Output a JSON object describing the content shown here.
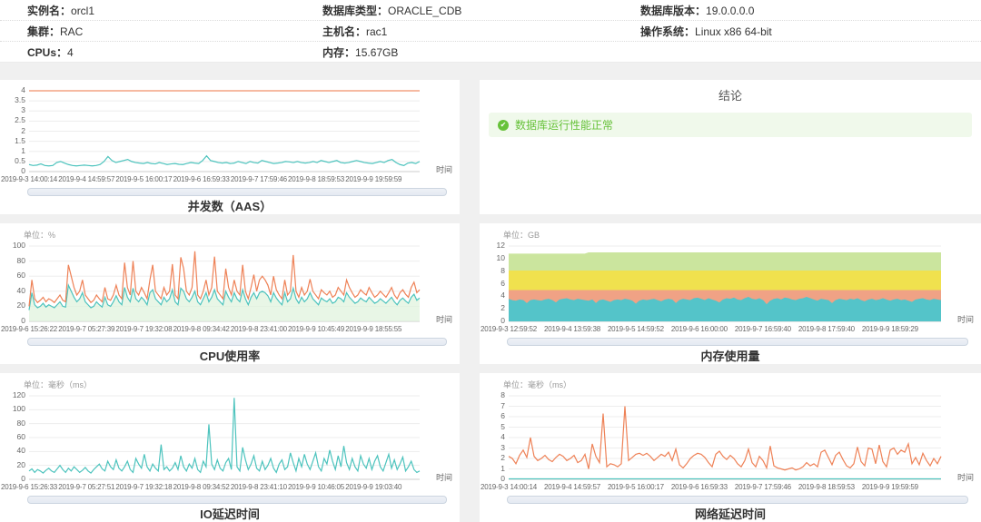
{
  "header": {
    "rows": [
      [
        {
          "label": "实例名：",
          "value": "orcl1"
        },
        {
          "label": "数据库类型：",
          "value": "ORACLE_CDB"
        },
        {
          "label": "数据库版本：",
          "value": "19.0.0.0.0"
        }
      ],
      [
        {
          "label": "集群：",
          "value": "RAC"
        },
        {
          "label": "主机名：",
          "value": "rac1"
        },
        {
          "label": "操作系统：",
          "value": "Linux x86 64-bit"
        }
      ],
      [
        {
          "label": "CPUs：",
          "value": "4"
        },
        {
          "label": "内存：",
          "value": "15.67GB"
        }
      ]
    ]
  },
  "conclusion": {
    "title": "结论",
    "icon_glyph": "✔",
    "icon_name": "check-circle-icon",
    "message": "数据库运行性能正常",
    "text_color": "#67c23a",
    "bg_color": "#f0f9eb"
  },
  "colors": {
    "orange_series": "#ee8156",
    "teal_series": "#4cc3bd",
    "mem_green": "#cbe59e",
    "mem_yellow": "#f0e14e",
    "mem_salmon": "#f0a285",
    "mem_teal": "#54c4c9"
  },
  "chart_data": [
    {
      "id": "aas",
      "type": "line",
      "title": "并发数（AAS）",
      "unit": null,
      "xlabel": "时间",
      "ylim": [
        0,
        4
      ],
      "yticks": [
        0,
        0.5,
        1,
        1.5,
        2,
        2.5,
        3,
        3.5,
        4
      ],
      "x_ticks": [
        "2019-9-3 14:00:14",
        "2019-9-4 14:59:57",
        "2019-9-5 16:00:17",
        "2019-9-6 16:59:33",
        "2019-9-7 17:59:46",
        "2019-9-8 18:59:53",
        "2019-9-9 19:59:59"
      ],
      "series": [
        {
          "color": "#f0916b",
          "flat": 4
        },
        {
          "color": "#4cc3bd",
          "values": [
            0.35,
            0.3,
            0.32,
            0.38,
            0.3,
            0.28,
            0.3,
            0.45,
            0.5,
            0.42,
            0.35,
            0.3,
            0.28,
            0.3,
            0.32,
            0.3,
            0.28,
            0.3,
            0.35,
            0.5,
            0.75,
            0.55,
            0.45,
            0.5,
            0.55,
            0.6,
            0.5,
            0.45,
            0.42,
            0.4,
            0.45,
            0.4,
            0.38,
            0.45,
            0.4,
            0.35,
            0.38,
            0.4,
            0.36,
            0.35,
            0.4,
            0.45,
            0.42,
            0.4,
            0.55,
            0.78,
            0.55,
            0.5,
            0.45,
            0.42,
            0.45,
            0.4,
            0.42,
            0.5,
            0.45,
            0.4,
            0.5,
            0.45,
            0.42,
            0.55,
            0.5,
            0.45,
            0.4,
            0.42,
            0.45,
            0.5,
            0.48,
            0.45,
            0.5,
            0.45,
            0.42,
            0.45,
            0.5,
            0.45,
            0.55,
            0.5,
            0.45,
            0.5,
            0.55,
            0.45,
            0.42,
            0.45,
            0.5,
            0.55,
            0.5,
            0.45,
            0.42,
            0.4,
            0.45,
            0.5,
            0.45,
            0.55,
            0.6,
            0.45,
            0.35,
            0.3,
            0.42,
            0.45,
            0.4,
            0.5
          ]
        }
      ]
    },
    {
      "id": "cpu",
      "type": "line",
      "title": "CPU使用率",
      "unit": "单位：%",
      "xlabel": "时间",
      "ylim": [
        0,
        100
      ],
      "yticks": [
        0,
        20,
        40,
        60,
        80,
        100
      ],
      "x_ticks": [
        "2019-9-6 15:26:22",
        "2019-9-7 05:27:39",
        "2019-9-7 19:32:08",
        "2019-9-8 09:34:42",
        "2019-9-8 23:41:00",
        "2019-9-9 10:45:49",
        "2019-9-9 18:55:55"
      ],
      "series": [
        {
          "color": "#4cc3bd",
          "fill": true,
          "fillColor": "rgba(222,242,220,0.7)",
          "values": [
            15,
            38,
            22,
            18,
            20,
            24,
            19,
            22,
            20,
            18,
            22,
            26,
            20,
            19,
            48,
            40,
            32,
            26,
            30,
            38,
            26,
            22,
            18,
            20,
            26,
            22,
            19,
            32,
            22,
            20,
            26,
            34,
            26,
            22,
            45,
            32,
            26,
            44,
            30,
            26,
            32,
            28,
            22,
            38,
            42,
            30,
            26,
            22,
            32,
            26,
            30,
            42,
            26,
            22,
            44,
            40,
            30,
            26,
            32,
            40,
            26,
            22,
            30,
            38,
            26,
            32,
            42,
            30,
            26,
            22,
            40,
            32,
            26,
            38,
            30,
            26,
            42,
            30,
            22,
            32,
            38,
            30,
            38,
            40,
            38,
            34,
            26,
            38,
            31,
            26,
            22,
            38,
            26,
            30,
            44,
            30,
            24,
            32,
            26,
            30,
            38,
            30,
            26,
            22,
            31,
            28,
            26,
            30,
            24,
            26,
            32,
            30,
            26,
            38,
            32,
            28,
            24,
            26,
            31,
            28,
            26,
            32,
            28,
            24,
            26,
            30,
            27,
            24,
            28,
            32,
            26,
            22,
            28,
            31,
            27,
            24,
            32,
            36,
            28,
            31
          ]
        },
        {
          "color": "#ee8156",
          "values": [
            20,
            55,
            30,
            25,
            28,
            32,
            26,
            30,
            28,
            25,
            30,
            35,
            28,
            26,
            75,
            60,
            45,
            35,
            40,
            55,
            35,
            30,
            25,
            28,
            35,
            30,
            26,
            45,
            30,
            28,
            35,
            48,
            35,
            30,
            78,
            45,
            35,
            80,
            40,
            35,
            45,
            38,
            30,
            55,
            75,
            40,
            35,
            30,
            45,
            35,
            40,
            76,
            35,
            30,
            85,
            70,
            40,
            35,
            45,
            93,
            35,
            30,
            40,
            55,
            35,
            45,
            86,
            40,
            35,
            30,
            70,
            45,
            35,
            55,
            40,
            35,
            75,
            40,
            30,
            45,
            62,
            40,
            55,
            60,
            55,
            48,
            35,
            60,
            42,
            35,
            30,
            55,
            35,
            40,
            88,
            40,
            32,
            45,
            35,
            40,
            56,
            40,
            35,
            30,
            42,
            38,
            35,
            40,
            32,
            35,
            45,
            40,
            35,
            55,
            45,
            38,
            32,
            35,
            42,
            38,
            35,
            45,
            38,
            32,
            35,
            40,
            36,
            32,
            38,
            45,
            35,
            30,
            38,
            42,
            36,
            32,
            45,
            52,
            38,
            42
          ]
        }
      ]
    },
    {
      "id": "memory",
      "type": "area-stacked",
      "title": "内存使用量",
      "unit": "单位：GB",
      "xlabel": "时间",
      "ylim": [
        0,
        12
      ],
      "yticks": [
        0,
        2,
        4,
        6,
        8,
        10,
        12
      ],
      "x_ticks": [
        "2019-9-3 12:59:52",
        "2019-9-4 13:59:38",
        "2019-9-5 14:59:52",
        "2019-9-6 16:00:00",
        "2019-9-7 16:59:40",
        "2019-9-8 17:59:40",
        "2019-9-9 18:59:29"
      ],
      "series": [
        {
          "color": "#cbe59e",
          "fill": true,
          "segments": [
            {
              "value": 10.7,
              "count": 22
            },
            {
              "value": 10.9,
              "count": 98
            }
          ]
        },
        {
          "color": "#f0e14e",
          "fill": true,
          "flat": 8
        },
        {
          "color": "#f0a285",
          "fill": true,
          "flat": 4.9
        },
        {
          "color": "#54c4c9",
          "fill": true,
          "values": [
            3.5,
            3.3,
            3.2,
            3.4,
            3.3,
            2.8,
            3.3,
            3.4,
            3.3,
            3.2,
            3.4,
            3.5,
            3.3,
            2.9,
            3.4,
            3.5,
            3.6,
            3.4,
            3.3,
            3.5,
            3.4,
            3.3,
            3.2,
            3.4,
            2.8,
            3.3,
            3.4,
            3.2,
            3.0,
            3.3,
            3.4,
            3.3,
            3.5,
            3.4,
            3.2,
            2.7,
            3.2,
            3.4,
            3.3,
            3.4,
            3.5,
            3.3,
            3.1,
            3.4,
            3.5,
            3.4,
            2.8,
            3.3,
            3.5,
            3.4,
            3.3,
            3.6,
            3.7,
            3.5,
            3.3,
            3.6,
            3.4,
            3.2,
            2.9,
            3.4,
            3.6,
            3.5,
            3.7,
            3.4,
            3.3,
            3.6,
            3.8,
            3.5,
            3.4,
            3.6,
            3.3,
            2.6,
            3.2,
            3.5,
            3.6,
            3.4,
            3.7,
            3.6,
            3.4,
            3.3,
            3.5,
            3.6,
            3.8,
            3.6,
            3.4,
            3.2,
            3.5,
            3.4,
            3.3,
            2.8,
            3.3,
            3.5,
            3.4,
            3.3,
            3.5,
            3.4,
            3.6,
            3.3,
            3.1,
            3.4,
            3.5,
            3.3,
            3.4,
            3.6,
            3.4,
            3.2,
            3.4,
            3.5,
            3.3,
            3.4,
            3.2,
            3.0,
            3.4,
            3.5,
            3.6,
            3.4,
            3.3,
            3.5,
            3.4,
            3.3
          ]
        }
      ]
    },
    {
      "id": "io",
      "type": "line",
      "title": "IO延迟时间",
      "unit": "单位：毫秒（ms）",
      "xlabel": "时间",
      "ylim": [
        0,
        120
      ],
      "yticks": [
        0,
        20,
        40,
        60,
        80,
        100,
        120
      ],
      "x_ticks": [
        "2019-9-6 15:26:33",
        "2019-9-7 05:27:51",
        "2019-9-7 19:32:18",
        "2019-9-8 09:34:52",
        "2019-9-8 23:41:10",
        "2019-9-9 10:46:05",
        "2019-9-9 19:03:40"
      ],
      "series": [
        {
          "color": "#4cc3bd",
          "values": [
            12,
            15,
            10,
            14,
            12,
            9,
            13,
            16,
            12,
            10,
            15,
            20,
            14,
            10,
            16,
            12,
            18,
            14,
            10,
            13,
            17,
            12,
            9,
            14,
            18,
            22,
            15,
            12,
            26,
            18,
            14,
            28,
            16,
            12,
            18,
            26,
            14,
            10,
            30,
            22,
            16,
            36,
            18,
            12,
            22,
            16,
            12,
            50,
            14,
            18,
            12,
            16,
            24,
            14,
            34,
            18,
            12,
            22,
            16,
            30,
            14,
            10,
            26,
            18,
            79,
            22,
            14,
            28,
            16,
            12,
            24,
            30,
            14,
            117,
            18,
            12,
            46,
            28,
            14,
            22,
            34,
            16,
            12,
            26,
            14,
            20,
            30,
            16,
            10,
            22,
            28,
            14,
            18,
            38,
            24,
            12,
            30,
            18,
            36,
            22,
            14,
            26,
            38,
            18,
            12,
            30,
            22,
            42,
            26,
            14,
            34,
            18,
            48,
            24,
            14,
            30,
            18,
            12,
            34,
            22,
            16,
            30,
            14,
            26,
            34,
            18,
            12,
            24,
            36,
            16,
            28,
            14,
            22,
            32,
            12,
            18,
            26,
            14,
            10,
            12
          ]
        }
      ]
    },
    {
      "id": "network",
      "type": "line",
      "title": "网络延迟时间",
      "unit": "单位：毫秒（ms）",
      "xlabel": "时间",
      "ylim": [
        0,
        8
      ],
      "yticks": [
        0,
        1,
        2,
        3,
        4,
        5,
        6,
        7,
        8
      ],
      "x_ticks": [
        "2019-9-3 14:00:14",
        "2019-9-4 14:59:57",
        "2019-9-5 16:00:17",
        "2019-9-6 16:59:33",
        "2019-9-7 17:59:46",
        "2019-9-8 18:59:53",
        "2019-9-9 19:59:59"
      ],
      "series": [
        {
          "color": "#4cc3bd",
          "flat": 0.05
        },
        {
          "color": "#ee8156",
          "values": [
            2.2,
            2.0,
            1.5,
            2.3,
            2.8,
            2.1,
            4.0,
            2.2,
            1.8,
            2.0,
            2.3,
            1.9,
            1.7,
            2.1,
            2.4,
            2.2,
            1.8,
            2.0,
            2.3,
            1.6,
            1.8,
            2.4,
            1.0,
            3.4,
            2.2,
            1.6,
            6.3,
            1.2,
            1.5,
            1.4,
            1.2,
            1.5,
            7.0,
            1.8,
            2.1,
            2.4,
            2.5,
            2.3,
            2.5,
            2.2,
            1.8,
            2.1,
            2.4,
            2.2,
            2.6,
            1.8,
            2.9,
            1.4,
            1.1,
            1.5,
            2.0,
            2.3,
            2.5,
            2.4,
            2.1,
            1.6,
            1.2,
            2.4,
            2.7,
            2.2,
            1.9,
            2.3,
            2.0,
            1.5,
            1.2,
            1.8,
            2.9,
            1.6,
            1.2,
            2.2,
            1.8,
            1.1,
            3.2,
            1.3,
            1.1,
            1.0,
            0.9,
            1.0,
            1.1,
            0.9,
            1.0,
            1.2,
            1.6,
            1.3,
            1.5,
            1.2,
            2.6,
            2.8,
            2.1,
            1.4,
            2.3,
            2.6,
            1.9,
            1.3,
            1.1,
            1.5,
            3.1,
            1.7,
            1.3,
            3.0,
            2.9,
            1.5,
            3.3,
            1.7,
            1.2,
            2.8,
            3.0,
            2.4,
            2.8,
            2.6,
            3.4,
            1.5,
            2.1,
            1.4,
            2.5,
            1.8,
            1.3,
            2.0,
            1.5,
            2.2
          ]
        }
      ]
    }
  ]
}
